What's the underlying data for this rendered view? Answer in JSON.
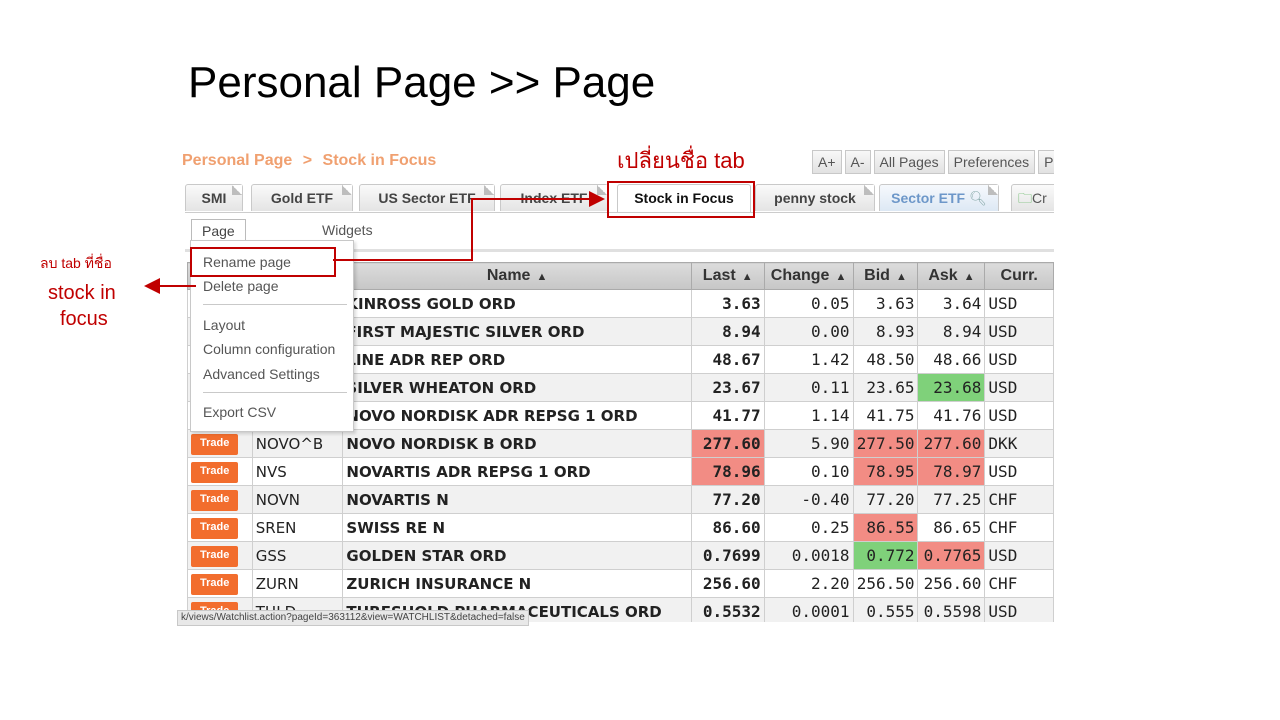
{
  "slide_title": "Personal Page >> Page",
  "breadcrumb": {
    "root": "Personal Page",
    "sep": ">",
    "current": "Stock in Focus"
  },
  "toolbar": [
    "A+",
    "A-",
    "All Pages",
    "Preferences",
    "P"
  ],
  "tabs": [
    "SMI",
    "Gold ETF",
    "US Sector ETF",
    "Index ETF",
    "Stock in Focus",
    "penny stock",
    "Sector ETF",
    "Cr"
  ],
  "subtabs": [
    "Page",
    "Widgets"
  ],
  "menu": {
    "rename": "Rename page",
    "delete": "Delete page",
    "layout": "Layout",
    "column_config": "Column configuration",
    "advanced": "Advanced Settings",
    "export": "Export CSV"
  },
  "table": {
    "headers": [
      "Name",
      "Last",
      "Change",
      "Bid",
      "Ask",
      "Curr."
    ],
    "trade_label": "Trade",
    "rows": [
      {
        "sym": "",
        "name": "KINROSS GOLD ORD",
        "last": "3.63",
        "change": "0.05",
        "bid": "3.63",
        "ask": "3.64",
        "curr": "USD"
      },
      {
        "sym": "",
        "name": "FIRST MAJESTIC SILVER ORD",
        "last": "8.94",
        "change": "0.00",
        "bid": "8.93",
        "ask": "8.94",
        "curr": "USD"
      },
      {
        "sym": "",
        "name": "LINE ADR REP ORD",
        "last": "48.67",
        "change": "1.42",
        "bid": "48.50",
        "ask": "48.66",
        "curr": "USD"
      },
      {
        "sym": "",
        "name": "SILVER WHEATON ORD",
        "last": "23.67",
        "change": "0.11",
        "bid": "23.65",
        "ask": "23.68",
        "curr": "USD"
      },
      {
        "sym": "",
        "name": "NOVO NORDISK ADR REPSG 1 ORD",
        "last": "41.77",
        "change": "1.14",
        "bid": "41.75",
        "ask": "41.76",
        "curr": "USD"
      },
      {
        "sym": "NOVO^B",
        "name": "NOVO NORDISK B ORD",
        "last": "277.60",
        "change": "5.90",
        "bid": "277.50",
        "ask": "277.60",
        "curr": "DKK"
      },
      {
        "sym": "NVS",
        "name": "NOVARTIS ADR REPSG 1 ORD",
        "last": "78.96",
        "change": "0.10",
        "bid": "78.95",
        "ask": "78.97",
        "curr": "USD"
      },
      {
        "sym": "NOVN",
        "name": "NOVARTIS N",
        "last": "77.20",
        "change": "-0.40",
        "bid": "77.20",
        "ask": "77.25",
        "curr": "CHF"
      },
      {
        "sym": "SREN",
        "name": "SWISS RE N",
        "last": "86.60",
        "change": "0.25",
        "bid": "86.55",
        "ask": "86.65",
        "curr": "CHF"
      },
      {
        "sym": "GSS",
        "name": "GOLDEN STAR ORD",
        "last": "0.7699",
        "change": "0.0018",
        "bid": "0.772",
        "ask": "0.7765",
        "curr": "USD"
      },
      {
        "sym": "ZURN",
        "name": "ZURICH INSURANCE N",
        "last": "256.60",
        "change": "2.20",
        "bid": "256.50",
        "ask": "256.60",
        "curr": "CHF"
      },
      {
        "sym": "THLD",
        "name": "THRESHOLD PHARMACEUTICALS ORD",
        "last": "0.5532",
        "change": "0.0001",
        "bid": "0.555",
        "ask": "0.5598",
        "curr": "USD"
      }
    ]
  },
  "status_url": "k/views/Watchlist.action?pageId=363112&view=WATCHLIST&detached=false",
  "annotations": {
    "rename_note": "เปลี่ยนชื่อ tab",
    "delete_note_line1": "ลบ tab ที่ชื่อ",
    "delete_note_line2": "stock in",
    "delete_note_line3": "focus"
  },
  "colors": {
    "accent": "#c00000",
    "trade": "#f26d2d",
    "up": "#7fd17a",
    "down": "#f28c84",
    "breadcrumb": "#f0a070"
  }
}
